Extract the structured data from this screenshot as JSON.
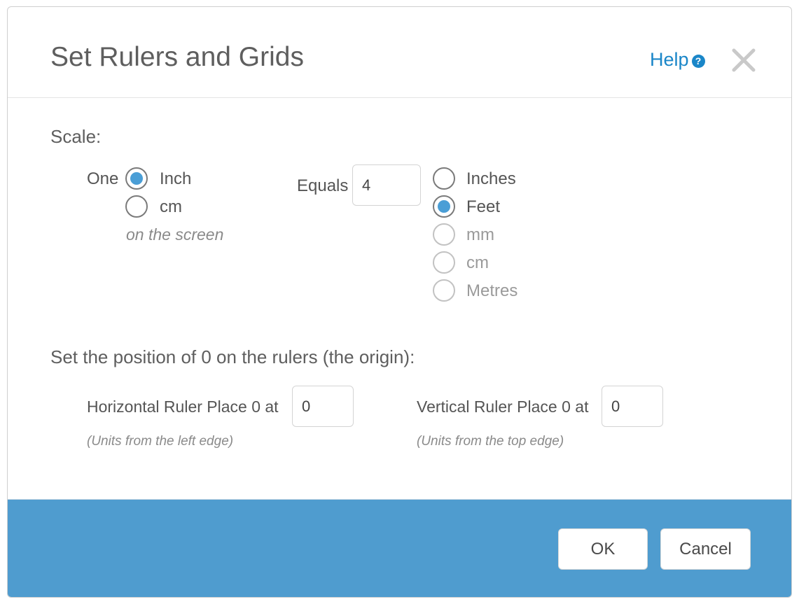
{
  "dialog": {
    "title": "Set Rulers and Grids",
    "help_label": "Help",
    "help_icon": "question-circle-icon",
    "close_icon": "close-x-icon"
  },
  "scale": {
    "section_label": "Scale:",
    "one_label": "One",
    "screen_units": [
      {
        "label": "Inch",
        "selected": true,
        "enabled": true
      },
      {
        "label": "cm",
        "selected": false,
        "enabled": true
      }
    ],
    "on_screen_note": "on the screen",
    "equals_label": "Equals",
    "equals_value": "4",
    "real_units": [
      {
        "label": "Inches",
        "selected": false,
        "enabled": true
      },
      {
        "label": "Feet",
        "selected": true,
        "enabled": true
      },
      {
        "label": "mm",
        "selected": false,
        "enabled": false
      },
      {
        "label": "cm",
        "selected": false,
        "enabled": false
      },
      {
        "label": "Metres",
        "selected": false,
        "enabled": false
      }
    ]
  },
  "origin": {
    "section_label": "Set the position of 0 on the rulers (the origin):",
    "horizontal_label": "Horizontal Ruler Place 0 at",
    "horizontal_value": "0",
    "horizontal_note": "(Units from the left edge)",
    "vertical_label": "Vertical Ruler Place 0 at",
    "vertical_value": "0",
    "vertical_note": "(Units from the top edge)"
  },
  "footer": {
    "ok_label": "OK",
    "cancel_label": "Cancel"
  },
  "colors": {
    "accent": "#4f9ccf",
    "link": "#1a86c8",
    "radio_selected": "#4a9ed6"
  }
}
